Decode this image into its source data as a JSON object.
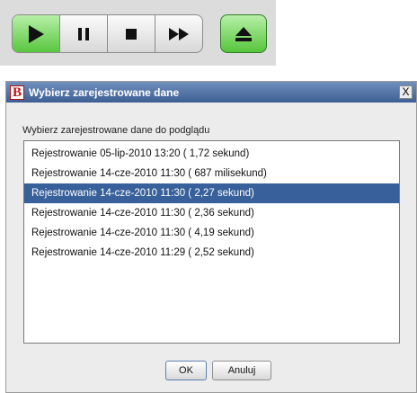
{
  "toolbar": {
    "buttons": [
      {
        "icon": "play-icon",
        "active": true
      },
      {
        "icon": "pause-icon"
      },
      {
        "icon": "stop-icon"
      },
      {
        "icon": "fast-forward-icon"
      }
    ],
    "eject": {
      "icon": "eject-icon"
    },
    "colors": {
      "active_green": "#58c73e",
      "icon": "#111111"
    }
  },
  "dialog": {
    "title": "Wybierz zarejestrowane dane",
    "app_icon_letter": "B",
    "close_label": "X",
    "prompt": "Wybierz zarejestrowane dane do podglądu",
    "items": [
      "Rejestrowanie 05-lip-2010 13:20 ( 1,72 sekund)",
      "Rejestrowanie 14-cze-2010 11:30 ( 687 milisekund)",
      "Rejestrowanie 14-cze-2010 11:30 ( 2,27 sekund)",
      "Rejestrowanie 14-cze-2010 11:30 ( 2,36 sekund)",
      "Rejestrowanie 14-cze-2010 11:30 ( 4,19 sekund)",
      "Rejestrowanie 14-cze-2010 11:29 ( 2,52 sekund)"
    ],
    "selected_index": 2,
    "ok_label": "OK",
    "cancel_label": "Anuluj",
    "colors": {
      "titlebar": "#3d5f93",
      "selection": "#38609a"
    }
  }
}
